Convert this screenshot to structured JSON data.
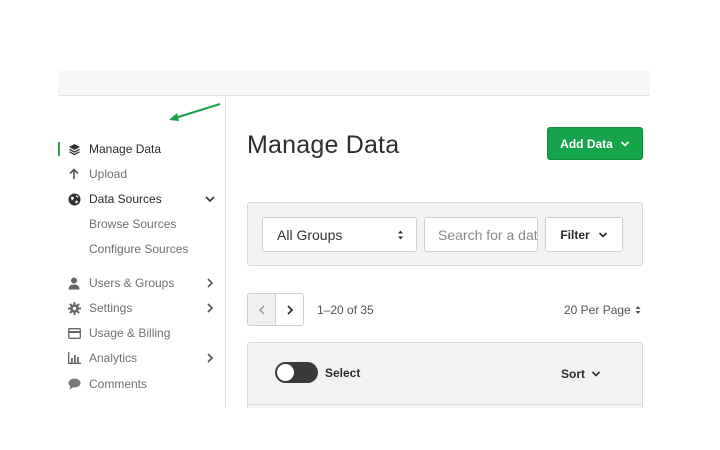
{
  "sidebar": {
    "items": [
      {
        "label": "Manage Data",
        "icon": "layers-icon"
      },
      {
        "label": "Upload",
        "icon": "arrow-up-icon"
      },
      {
        "label": "Data Sources",
        "icon": "globe-icon"
      },
      {
        "label": "Browse Sources"
      },
      {
        "label": "Configure Sources"
      },
      {
        "label": "Users & Groups",
        "icon": "user-icon"
      },
      {
        "label": "Settings",
        "icon": "gear-icon"
      },
      {
        "label": "Usage & Billing",
        "icon": "credit-card-icon"
      },
      {
        "label": "Analytics",
        "icon": "bar-chart-icon"
      },
      {
        "label": "Comments",
        "icon": "comment-icon"
      }
    ]
  },
  "main": {
    "title": "Manage Data",
    "add_button": "Add Data",
    "filters": {
      "group_select": "All Groups",
      "search_placeholder": "Search for a dataset",
      "filter_button": "Filter"
    },
    "pagination": {
      "range": "1–20 of 35",
      "per_page": "20 Per Page"
    },
    "list": {
      "select_label": "Select",
      "sort_label": "Sort"
    }
  },
  "colors": {
    "accent": "#16a34a",
    "arrow": "#1f9e4a"
  }
}
